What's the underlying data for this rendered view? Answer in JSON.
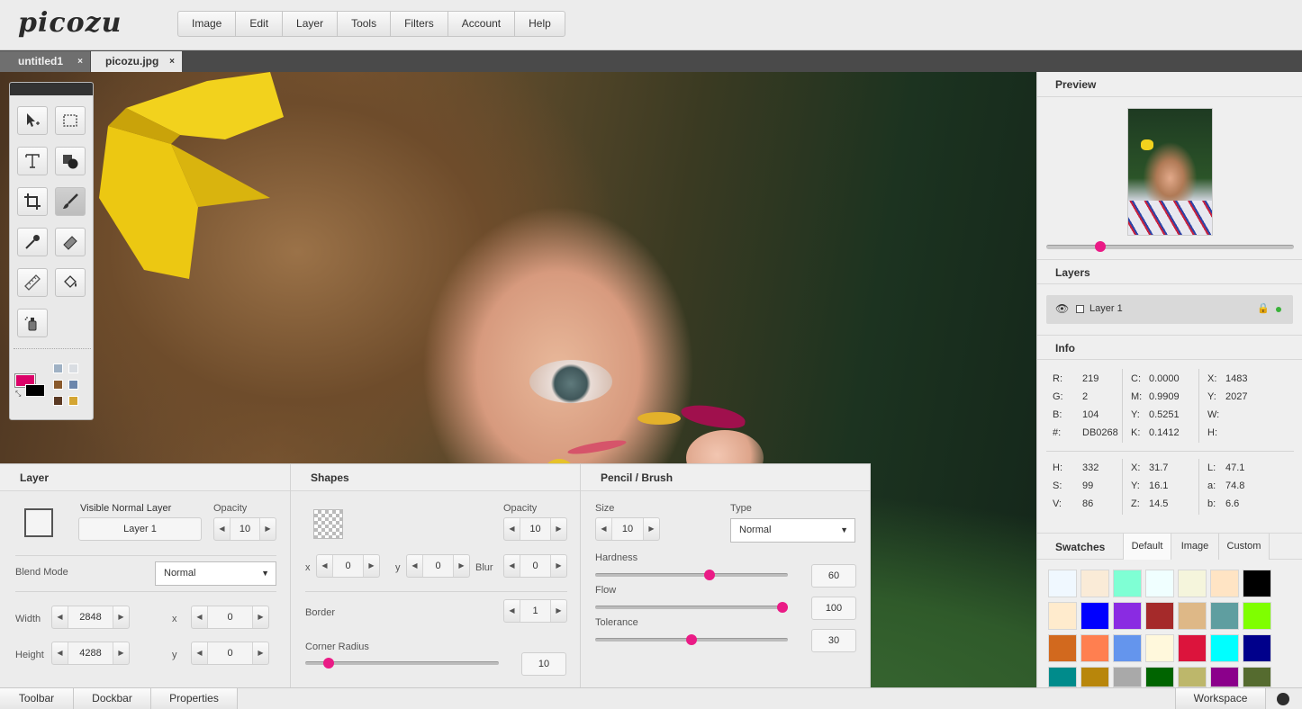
{
  "app": {
    "logo": "picozu"
  },
  "menu": [
    "Image",
    "Edit",
    "Layer",
    "Tools",
    "Filters",
    "Account",
    "Help"
  ],
  "tabs": [
    {
      "label": "untitled1",
      "close": "×"
    },
    {
      "label": "picozu.jpg",
      "close": "×"
    }
  ],
  "toolbar": {
    "tools": [
      "move-tool",
      "marquee-tool",
      "text-tool",
      "shapes-tool",
      "crop-tool",
      "brush-tool",
      "eyedropper-tool",
      "eraser-tool",
      "ruler-tool",
      "fill-tool",
      "spray-tool"
    ],
    "primary_color": "#DB0268",
    "secondary_color": "#000000",
    "mini_swatches": [
      "#9fb1c4",
      "#d9dde2",
      "#8a5a2c",
      "#6b86ac",
      "#5b3a24",
      "#d4a532"
    ]
  },
  "layer_panel": {
    "title": "Layer",
    "visible_label": "Visible Normal Layer",
    "opacity_label": "Opacity",
    "opacity": "10",
    "layer_name": "Layer 1",
    "blend_label": "Blend Mode",
    "blend_value": "Normal",
    "width_label": "Width",
    "width": "2848",
    "height_label": "Height",
    "height": "4288",
    "x_label": "x",
    "x": "0",
    "y_label": "y",
    "y": "0"
  },
  "shapes_panel": {
    "title": "Shapes",
    "opacity_label": "Opacity",
    "opacity": "10",
    "x_label": "x",
    "x": "0",
    "y_label": "y",
    "y": "0",
    "blur_label": "Blur",
    "blur": "0",
    "border_label": "Border",
    "border": "1",
    "corner_label": "Corner Radius",
    "corner": "10",
    "corner_level": 0.1
  },
  "brush_panel": {
    "title": "Pencil / Brush",
    "size_label": "Size",
    "size": "10",
    "type_label": "Type",
    "type_value": "Normal",
    "hardness_label": "Hardness",
    "hardness": "60",
    "hardness_level": 0.6,
    "flow_label": "Flow",
    "flow": "100",
    "flow_level": 1.0,
    "tolerance_label": "Tolerance",
    "tolerance": "30",
    "tolerance_level": 0.5
  },
  "right_panel": {
    "preview_title": "Preview",
    "layers_title": "Layers",
    "layer_name": "Layer 1",
    "info_title": "Info",
    "info": {
      "r_label": "R:",
      "r": "219",
      "g_label": "G:",
      "g": "2",
      "b_label": "B:",
      "b": "104",
      "hex_label": "#:",
      "hex": "DB0268",
      "c_label": "C:",
      "c": "0.0000",
      "m_label": "M:",
      "m": "0.9909",
      "yk_label": "Y:",
      "yk": "0.5251",
      "k_label": "K:",
      "k": "0.1412",
      "x_label": "X:",
      "x": "1483",
      "y_label": "Y:",
      "y": "2027",
      "w_label": "W:",
      "h_label": "H:",
      "hh_label": "H:",
      "hh": "332",
      "s_label": "S:",
      "s": "99",
      "v_label": "V:",
      "v": "86",
      "xx_label": "X:",
      "xx": "31.7",
      "yy_label": "Y:",
      "yy": "16.1",
      "zz_label": "Z:",
      "zz": "14.5",
      "l_label": "L:",
      "l": "47.1",
      "a_label": "a:",
      "a": "74.8",
      "bb_label": "b:",
      "bb": "6.6"
    },
    "swatches_title": "Swatches",
    "swatch_tabs": [
      "Default",
      "Image",
      "Custom"
    ],
    "swatches": [
      "#f0f8ff",
      "#faebd7",
      "#7fffd4",
      "#f0ffff",
      "#f5f5dc",
      "#ffe4c4",
      "#000000",
      "#ffebcd",
      "#0000ff",
      "#8a2be2",
      "#a52a2a",
      "#deb887",
      "#5f9ea0",
      "#7fff00",
      "#d2691e",
      "#ff7f50",
      "#6495ed",
      "#fff8dc",
      "#dc143c",
      "#00ffff",
      "#00008b",
      "#008b8b",
      "#b8860b",
      "#a9a9a9",
      "#006400",
      "#bdb76b",
      "#8b008b",
      "#556b2f"
    ]
  },
  "bottombar": {
    "toolbar": "Toolbar",
    "dockbar": "Dockbar",
    "properties": "Properties",
    "workspace": "Workspace"
  }
}
